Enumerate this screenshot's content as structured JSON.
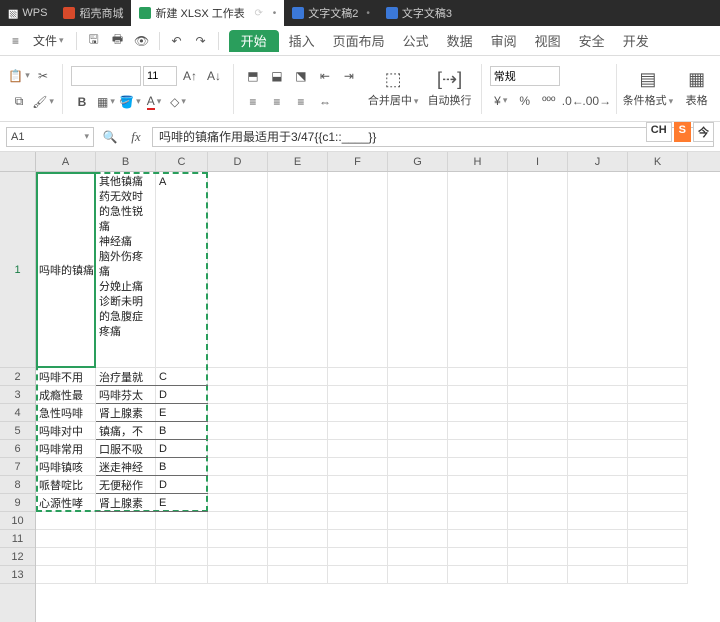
{
  "titlebar": {
    "app_label": "WPS",
    "tabs": [
      {
        "label": "稻壳商城",
        "icon": "red"
      },
      {
        "label": "新建 XLSX 工作表",
        "icon": "green",
        "active": true,
        "sync": "⟳",
        "dot": "•"
      },
      {
        "label": "文字文稿2",
        "icon": "blue",
        "dot": "•"
      },
      {
        "label": "文字文稿3",
        "icon": "blue"
      }
    ]
  },
  "menubar": {
    "file": "文件",
    "menus": [
      "插入",
      "页面布局",
      "公式",
      "数据",
      "审阅",
      "视图",
      "安全",
      "开发"
    ],
    "start": "开始"
  },
  "ribbon": {
    "font_size": "11",
    "number_format": "常规",
    "merge": "合并居中",
    "wrap": "自动换行",
    "cond_format": "条件格式",
    "table_style": "表格"
  },
  "namebox": "A1",
  "formula": "吗啡的镇痛作用最适用于3/47{{c1::____}}",
  "columns": [
    "A",
    "B",
    "C",
    "D",
    "E",
    "F",
    "G",
    "H",
    "I",
    "J",
    "K"
  ],
  "rows": [
    "1",
    "2",
    "3",
    "4",
    "5",
    "6",
    "7",
    "8",
    "9",
    "10",
    "11",
    "12",
    "13"
  ],
  "data": {
    "A1": "吗啡的镇痛",
    "B1": "其他镇痛药无效时的急性锐痛\n神经痛\n脑外伤疼痛\n分娩止痛\n诊断未明的急腹症疼痛",
    "C1": "A",
    "A2": "吗啡不用",
    "B2": "治疗量就",
    "C2": "C",
    "A3": "成瘾性最",
    "B3": "吗啡芬太",
    "C3": "D",
    "A4": "急性吗啡",
    "B4": "肾上腺素",
    "C4": "E",
    "A5": "吗啡对中",
    "B5": "镇痛，不",
    "C5": "B",
    "A6": "吗啡常用",
    "B6": "口服不吸",
    "C6": "D",
    "A7": "吗啡镇咳",
    "B7": "迷走神经",
    "C7": "B",
    "A8": "哌替啶比",
    "B8": "无便秘作",
    "C8": "D",
    "A9": "心源性哮",
    "B9": "肾上腺素",
    "C9": "E"
  },
  "ime": {
    "ch": "CH",
    "s": "S"
  }
}
